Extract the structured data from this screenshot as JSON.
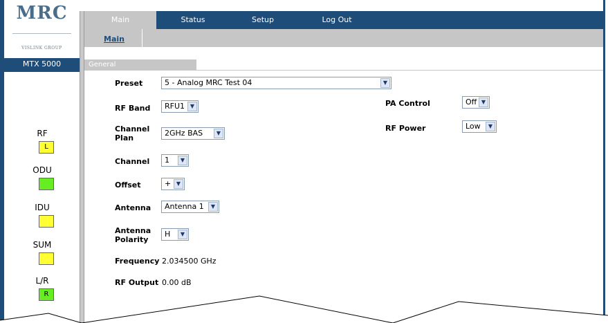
{
  "brand": {
    "logo": "MRC",
    "sub": "VISLINK GROUP",
    "model": "MTX 5000"
  },
  "indicators": [
    {
      "label": "RF",
      "led_text": "L",
      "color": "#ffff33"
    },
    {
      "label": "ODU",
      "led_text": "",
      "color": "#66ee22"
    },
    {
      "label": "IDU",
      "led_text": "",
      "color": "#ffff33"
    },
    {
      "label": "SUM",
      "led_text": "",
      "color": "#ffff33"
    },
    {
      "label": "L/R",
      "led_text": "R",
      "color": "#66ee22"
    }
  ],
  "nav": {
    "tabs": [
      "Main",
      "Status",
      "Setup",
      "Log Out"
    ],
    "active": "Main",
    "subtab": "Main"
  },
  "section": "General",
  "fields": {
    "preset": {
      "label": "Preset",
      "value": "5 - Analog MRC Test 04"
    },
    "rf_band": {
      "label": "RF Band",
      "value": "RFU1"
    },
    "channel_plan": {
      "label_line1": "Channel",
      "label_line2": "Plan",
      "value": "2GHz BAS"
    },
    "channel": {
      "label": "Channel",
      "value": "1"
    },
    "offset": {
      "label": "Offset",
      "value": "+"
    },
    "antenna": {
      "label": "Antenna",
      "value": "Antenna 1"
    },
    "antenna_polarity": {
      "label_line1": "Antenna",
      "label_line2": "Polarity",
      "value": "H"
    },
    "frequency": {
      "label": "Frequency",
      "value": "2.034500 GHz"
    },
    "rf_output": {
      "label": "RF Output",
      "value": "0.00 dB"
    },
    "pa_control": {
      "label": "PA Control",
      "value": "Off"
    },
    "rf_power": {
      "label": "RF Power",
      "value": "Low"
    }
  },
  "colors": {
    "navy": "#1f4d7a",
    "gray": "#c6c6c6",
    "led_yellow": "#ffff33",
    "led_green": "#66ee22"
  }
}
